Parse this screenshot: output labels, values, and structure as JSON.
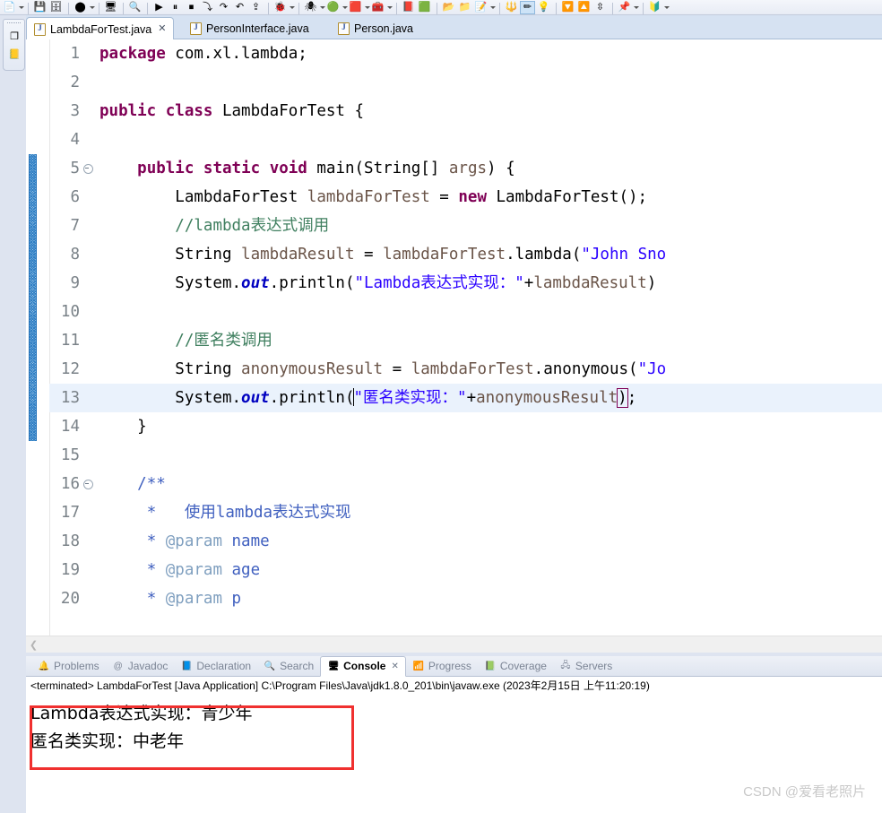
{
  "app": {
    "name": "Eclipse IDE",
    "watermark": "CSDN @爱看老照片"
  },
  "toolbar": {
    "items": [
      {
        "name": "new-wizard",
        "glyph": "📄"
      },
      {
        "name": "save",
        "glyph": "💾"
      },
      {
        "name": "save-all",
        "glyph": "🗄"
      },
      {
        "name": "print",
        "glyph": "⬤"
      },
      {
        "name": "open-terminal",
        "glyph": "🖥"
      },
      {
        "name": "search",
        "glyph": "🔍"
      },
      {
        "name": "debug-resume",
        "glyph": "▶"
      },
      {
        "name": "debug-suspend",
        "glyph": "⏸"
      },
      {
        "name": "debug-terminate",
        "glyph": "⏹"
      },
      {
        "name": "debug-step-into",
        "glyph": "⤵"
      },
      {
        "name": "debug-step-over",
        "glyph": "↷"
      },
      {
        "name": "debug-step-return",
        "glyph": "↶"
      },
      {
        "name": "debug-last-launch",
        "glyph": "🐞"
      },
      {
        "name": "run-last-launch",
        "glyph": "▶"
      },
      {
        "name": "run-coverage",
        "glyph": "🟥"
      },
      {
        "name": "external-tools",
        "glyph": "🧰"
      },
      {
        "name": "open-type",
        "glyph": "📕"
      },
      {
        "name": "git-repo",
        "glyph": "🟢"
      },
      {
        "name": "open-folder",
        "glyph": "📂"
      },
      {
        "name": "new-folder",
        "glyph": "📁"
      },
      {
        "name": "new-java-file",
        "glyph": "📝"
      },
      {
        "name": "annotation-toggle",
        "glyph": "🔧"
      },
      {
        "name": "pencil",
        "glyph": "✏"
      },
      {
        "name": "bulb",
        "glyph": "💡"
      },
      {
        "name": "next-annotation",
        "glyph": "🔽"
      },
      {
        "name": "prev-annotation",
        "glyph": "🔼"
      },
      {
        "name": "toggle-mark",
        "glyph": "🔀"
      },
      {
        "name": "pin-editor",
        "glyph": "📌"
      },
      {
        "name": "perspective",
        "glyph": "🔱"
      }
    ]
  },
  "left_rail": {
    "items": [
      {
        "name": "restore-icon",
        "glyph": "❐"
      },
      {
        "name": "package-explorer-icon",
        "glyph": "📒"
      }
    ]
  },
  "editor_tabs": [
    {
      "label": "LambdaForTest.java",
      "active": true,
      "close": "✕"
    },
    {
      "label": "PersonInterface.java",
      "active": false,
      "close": ""
    },
    {
      "label": "Person.java",
      "active": false,
      "close": ""
    }
  ],
  "editor": {
    "change_bar_start_line": 5,
    "change_bar_end_line": 14,
    "highlighted_line": 13,
    "lines": [
      {
        "n": "1",
        "fold": false,
        "html": "<span class=\"kw\">package</span> com.xl.lambda;"
      },
      {
        "n": "2",
        "fold": false,
        "html": ""
      },
      {
        "n": "3",
        "fold": false,
        "html": "<span class=\"kw\">public</span> <span class=\"kw\">class</span> LambdaForTest {"
      },
      {
        "n": "4",
        "fold": false,
        "html": ""
      },
      {
        "n": "5",
        "fold": true,
        "html": "    <span class=\"kw\">public</span> <span class=\"kw\">static</span> <span class=\"kw\">void</span> main(String[] <span class=\"par\">args</span>) {"
      },
      {
        "n": "6",
        "fold": false,
        "html": "        LambdaForTest <span class=\"loc\">lambdaForTest</span> = <span class=\"kw\">new</span> LambdaForTest();"
      },
      {
        "n": "7",
        "fold": false,
        "html": "        <span class=\"cmt\">//lambda表达式调用</span>"
      },
      {
        "n": "8",
        "fold": false,
        "html": "        String <span class=\"loc\">lambdaResult</span> = <span class=\"loc\">lambdaForTest</span>.lambda(<span class=\"str\">\"John Sno</span>"
      },
      {
        "n": "9",
        "fold": false,
        "html": "        System.<span class=\"fld\">out</span>.println(<span class=\"str\">\"Lambda表达式实现：\"</span>+<span class=\"loc\">lambdaResult</span>)"
      },
      {
        "n": "10",
        "fold": false,
        "html": ""
      },
      {
        "n": "11",
        "fold": false,
        "html": "        <span class=\"cmt\">//匿名类调用</span>"
      },
      {
        "n": "12",
        "fold": false,
        "html": "        String <span class=\"loc\">anonymousResult</span> = <span class=\"loc\">lambdaForTest</span>.anonymous(<span class=\"str\">\"Jo</span>"
      },
      {
        "n": "13",
        "fold": false,
        "html": "        System.<span class=\"fld\">out</span>.println(<span class=\"caret\"></span><span class=\"str\">\"匿名类实现：\"</span>+<span class=\"loc\">anonymousResult</span><span class=\"mbrace\">)</span>;"
      },
      {
        "n": "14",
        "fold": false,
        "html": "    }"
      },
      {
        "n": "15",
        "fold": false,
        "html": ""
      },
      {
        "n": "16",
        "fold": true,
        "html": "    <span class=\"jdoc\">/**</span>"
      },
      {
        "n": "17",
        "fold": false,
        "html": "     <span class=\"jdoc\">*   使用lambda表达式实现</span>"
      },
      {
        "n": "18",
        "fold": false,
        "html": "     <span class=\"jdoc\">* </span><span class=\"jtag\">@param</span><span class=\"jdoc\"> name</span>"
      },
      {
        "n": "19",
        "fold": false,
        "html": "     <span class=\"jdoc\">* </span><span class=\"jtag\">@param</span><span class=\"jdoc\"> age</span>"
      },
      {
        "n": "20",
        "fold": false,
        "html": "     <span class=\"jdoc\">* </span><span class=\"jtag\">@param</span><span class=\"jdoc\"> p</span>"
      }
    ],
    "hscroll_left_arrow": "❮"
  },
  "bottom_view": {
    "tabs": [
      {
        "label": "Problems",
        "active": false,
        "icon": "problems-icon",
        "glyph": "🔔"
      },
      {
        "label": "Javadoc",
        "active": false,
        "icon": "javadoc-icon",
        "glyph": "@"
      },
      {
        "label": "Declaration",
        "active": false,
        "icon": "declaration-icon",
        "glyph": "📘"
      },
      {
        "label": "Search",
        "active": false,
        "icon": "search-icon",
        "glyph": "🔍"
      },
      {
        "label": "Console",
        "active": true,
        "icon": "console-icon",
        "glyph": "🖥",
        "close": "✕"
      },
      {
        "label": "Progress",
        "active": false,
        "icon": "progress-icon",
        "glyph": "📶"
      },
      {
        "label": "Coverage",
        "active": false,
        "icon": "coverage-icon",
        "glyph": "📗"
      },
      {
        "label": "Servers",
        "active": false,
        "icon": "servers-icon",
        "glyph": "🖧"
      }
    ],
    "status_line": "<terminated> LambdaForTest [Java Application] C:\\Program Files\\Java\\jdk1.8.0_201\\bin\\javaw.exe (2023年2月15日 上午11:20:19)",
    "output_lines": [
      "Lambda表达式实现：青少年",
      "匿名类实现：中老年"
    ],
    "annotation_color": "#f0302f"
  }
}
